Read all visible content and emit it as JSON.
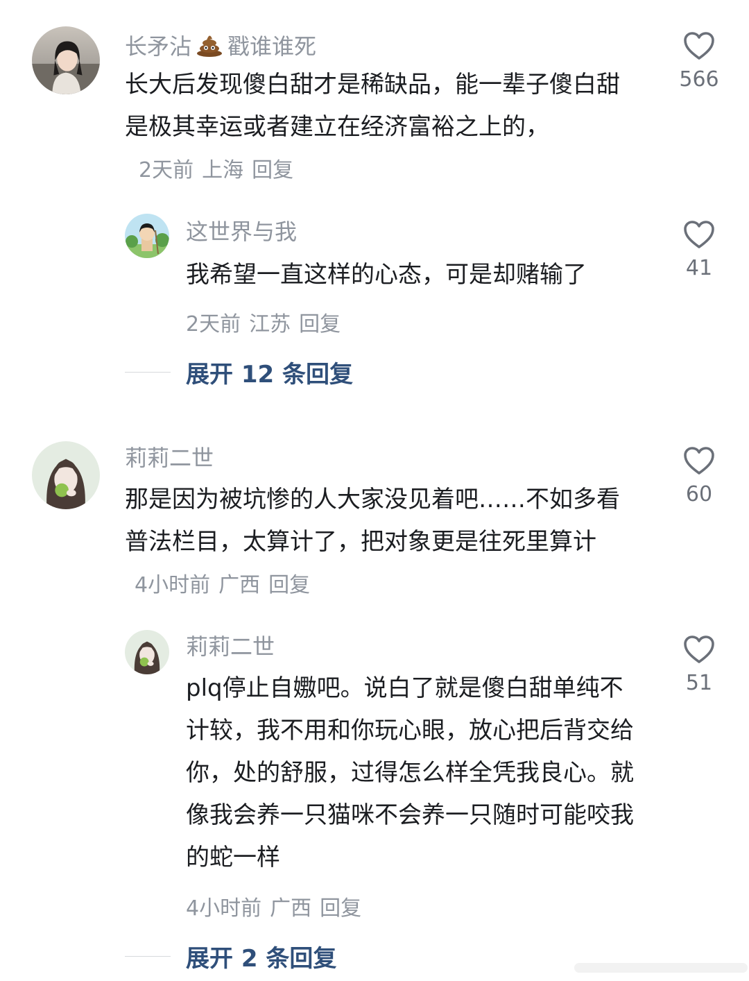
{
  "comments": [
    {
      "username_before": "长矛沾",
      "username_emoji": "poop-emoji",
      "username_after": "戳谁谁死",
      "text": "长大后发现傻白甜才是稀缺品，能一辈子傻白甜是极其幸运或者建立在经济富裕之上的，",
      "time": "2天前",
      "location": "上海",
      "reply_label": "回复",
      "likes": "566",
      "replies": [
        {
          "username": "这世界与我",
          "text": "我希望一直这样的心态，可是却赌输了",
          "time": "2天前",
          "location": "江苏",
          "reply_label": "回复",
          "likes": "41"
        }
      ],
      "expand_label": "展开 12 条回复"
    },
    {
      "username": "莉莉二世",
      "text": "那是因为被坑惨的人大家没见着吧……不如多看普法栏目，太算计了，把对象更是往死里算计",
      "time": "4小时前",
      "location": "广西",
      "reply_label": "回复",
      "likes": "60",
      "replies": [
        {
          "username": "莉莉二世",
          "text": "plq停止自嫐吧。说白了就是傻白甜单纯不计较，我不用和你玩心眼，放心把后背交给你，处的舒服，过得怎么样全凭我良心。就像我会养一只猫咪不会养一只随时可能咬我的蛇一样",
          "time": "4小时前",
          "location": "广西",
          "reply_label": "回复",
          "likes": "51"
        }
      ],
      "expand_label": "展开 2 条回复"
    }
  ],
  "icons": {
    "like": "heart-outline-icon"
  },
  "colors": {
    "username": "#8f959e",
    "text": "#1b1d21",
    "meta": "#8f959e",
    "expand": "#2f4f7a",
    "like_count": "#6b7079"
  }
}
